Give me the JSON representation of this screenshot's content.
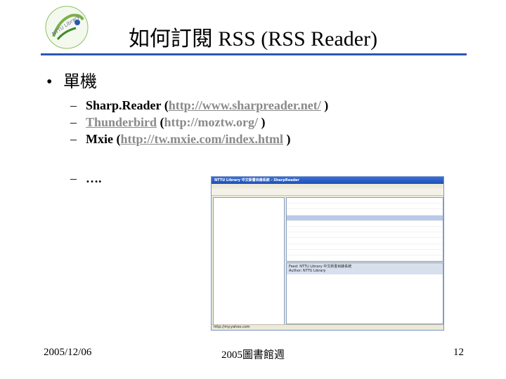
{
  "slide": {
    "title": "如何訂閱 RSS (RSS Reader)",
    "bullet": "單機",
    "items": [
      {
        "name": "Sharp.Reader",
        "url": "http://www.sharpreader.net/"
      },
      {
        "name": "Thunderbird",
        "url": "http://moztw.org/"
      },
      {
        "name": "Mxie",
        "url": "http://tw.mxie.com/index.html"
      },
      {
        "name": "…."
      }
    ],
    "footer_left": "2005/12/06",
    "footer_center": "2005圖書館週",
    "footer_right": "12",
    "logo_text": "NTTU Library"
  },
  "screenshot": {
    "window_title": "NTTU Library 中文新書目錄系統 - SharpReader",
    "status": "http://my.yahoo.com",
    "preview_feed": "Feed: NTTU Library 中文新書目錄系統",
    "preview_author": "Author: NTTU Library"
  }
}
